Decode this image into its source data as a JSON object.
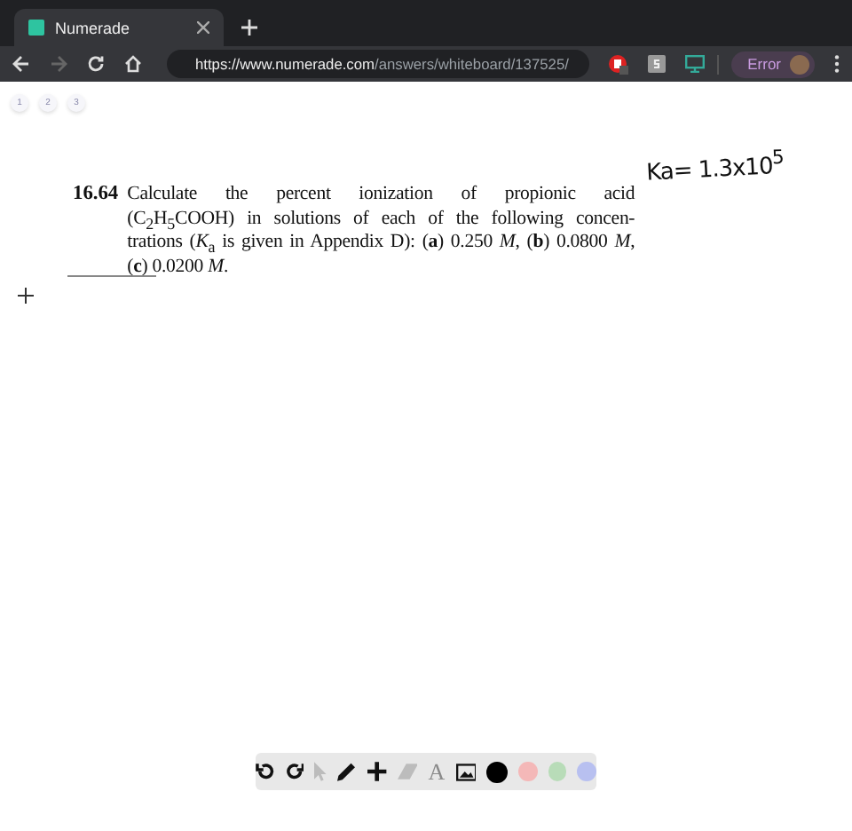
{
  "tab": {
    "title": "Numerade",
    "selected": true
  },
  "address_bar": {
    "host": "https://www.numerade.com",
    "path": "/answers/whiteboard/137525/"
  },
  "nav": {
    "back_disabled": false,
    "forward_disabled": true
  },
  "profile": {
    "status": "Error"
  },
  "pages": [
    {
      "label": "1",
      "selected": false
    },
    {
      "label": "2",
      "selected": false
    },
    {
      "label": "3",
      "selected": false
    }
  ],
  "problem": {
    "number": "16.64",
    "lines": [
      "Calculate the percent ionization of propionic acid",
      "(C$_{2}$H$_{5}$COOH) in solutions of each of the following concen-",
      "trations (*K*$_{a}$ is given in Appendix D): (**a**) 0.250 *M*, (**b**) 0.0800 *M*,",
      "(**c**) 0.0200 *M*."
    ]
  },
  "handwriting": "Ka= 1.3x10$^{5}$",
  "toolbar": {
    "tools": [
      {
        "kind": "undo",
        "disabled": false
      },
      {
        "kind": "redo",
        "disabled": false
      },
      {
        "kind": "pointer",
        "disabled": true
      },
      {
        "kind": "pen",
        "disabled": false
      },
      {
        "kind": "cross",
        "disabled": false
      },
      {
        "kind": "eraser",
        "disabled": true
      },
      {
        "kind": "text",
        "label": "A",
        "disabled": true
      },
      {
        "kind": "image",
        "disabled": false
      }
    ],
    "colors": [
      {
        "color": "#000000",
        "selected": true
      },
      {
        "color": "#f4b8b8",
        "selected": false
      },
      {
        "color": "#b8dcb8",
        "selected": false
      },
      {
        "color": "#b8c0f0",
        "selected": false
      }
    ]
  }
}
